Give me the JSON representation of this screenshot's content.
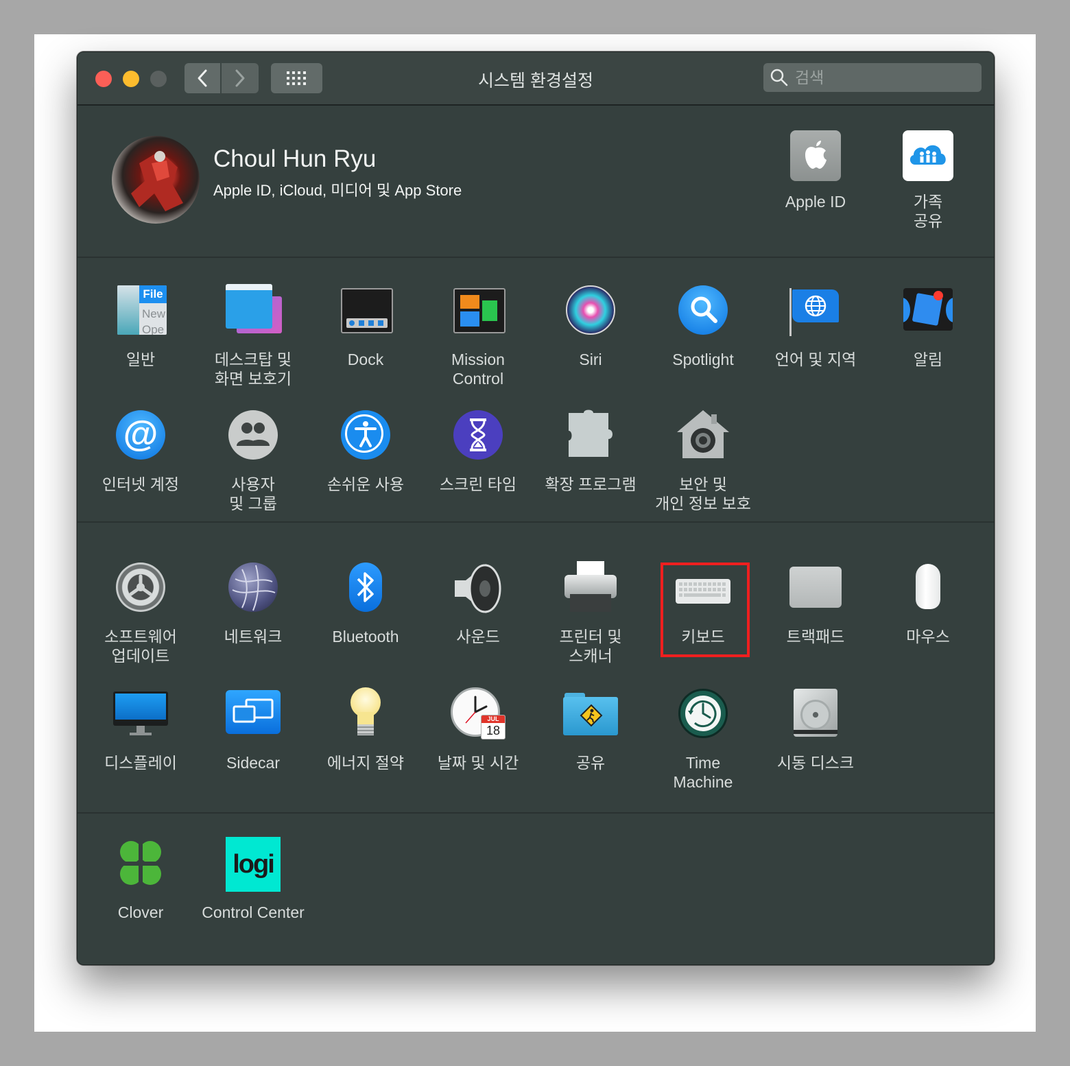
{
  "window": {
    "title": "시스템 환경설정"
  },
  "search": {
    "placeholder": "검색"
  },
  "account": {
    "name": "Choul Hun Ryu",
    "subtitle": "Apple ID, iCloud, 미디어 및 App Store",
    "apple_id_label": "Apple ID",
    "family_label": "가족\n공유"
  },
  "panes": {
    "row1": [
      "일반",
      "데스크탑 및\n화면 보호기",
      "Dock",
      "Mission\nControl",
      "Siri",
      "Spotlight",
      "언어 및 지역",
      "알림"
    ],
    "row2": [
      "인터넷 계정",
      "사용자\n및 그룹",
      "손쉬운 사용",
      "스크린 타임",
      "확장 프로그램",
      "보안 및\n개인 정보 보호"
    ],
    "row3": [
      "소프트웨어\n업데이트",
      "네트워크",
      "Bluetooth",
      "사운드",
      "프린터 및\n스캐너",
      "키보드",
      "트랙패드",
      "마우스"
    ],
    "row4": [
      "디스플레이",
      "Sidecar",
      "에너지 절약",
      "날짜 및 시간",
      "공유",
      "Time\nMachine",
      "시동 디스크"
    ],
    "row5": [
      "Clover",
      "Control Center"
    ]
  },
  "icon_text": {
    "general_file": "File",
    "general_new": "New",
    "general_open": "Ope",
    "logi": "logi",
    "calendar_month": "JUL",
    "calendar_day": "18"
  },
  "highlighted_pane": "키보드",
  "colors": {
    "window_bg": "#35403e",
    "highlight": "#ef1f1f",
    "close": "#fc5f57",
    "minimize": "#fdbc2e"
  }
}
